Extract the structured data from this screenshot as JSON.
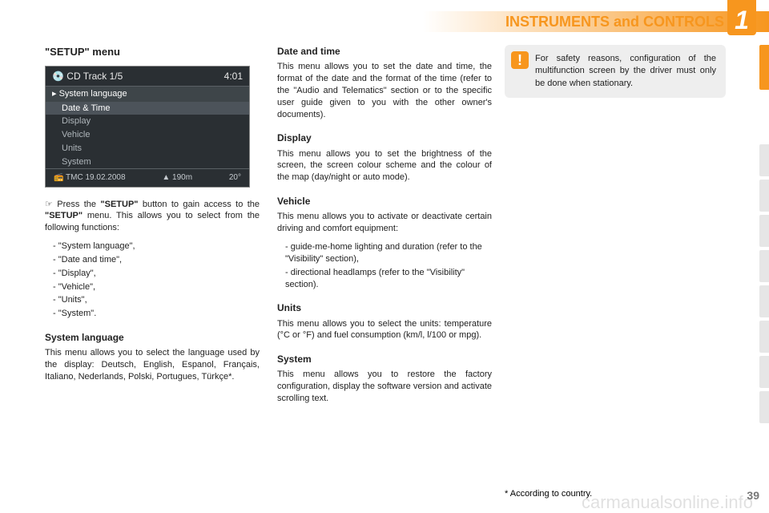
{
  "header": {
    "title": "INSTRUMENTS and CONTROLS",
    "chapter": "1"
  },
  "col1": {
    "heading": "\"SETUP\" menu",
    "screenshot": {
      "top_left": "💿 CD    Track 1/5",
      "top_right": "4:01",
      "menu_title": "▸ System language",
      "items": [
        "Date & Time",
        "Display",
        "Vehicle",
        "Units",
        "System"
      ],
      "bottom_left": "📻 TMC    19.02.2008",
      "bottom_mid": "▲ 190m",
      "bottom_right": "20°"
    },
    "press_text_pre": "☞  Press the ",
    "press_setup1": "\"SETUP\"",
    "press_text_mid": " button to gain access to the ",
    "press_setup2": "\"SETUP\"",
    "press_text_post": " menu. This allows you to select from the following functions:",
    "functions": [
      "-  \"System language\",",
      "-  \"Date and time\",",
      "-  \"Display\",",
      "-  \"Vehicle\",",
      "-  \"Units\",",
      "-  \"System\"."
    ],
    "syslang_h": "System language",
    "syslang_p": "This menu allows you to select the language used by the display: Deutsch, English, Espanol, Français, Italiano, Nederlands, Polski, Portugues, Türkçe*."
  },
  "col2": {
    "date_h": "Date and time",
    "date_p": "This menu allows you to set the date and time, the format of the date and the format of the time (refer to the \"Audio and Telematics\" section or to the specific user guide given to you with the other owner's documents).",
    "disp_h": "Display",
    "disp_p": "This menu allows you to set the brightness of the screen, the screen colour scheme and the colour of the map (day/night or auto mode).",
    "veh_h": "Vehicle",
    "veh_p": "This menu allows you to activate or deactivate certain driving and comfort equipment:",
    "veh_items": [
      "-  guide-me-home lighting and duration (refer to the \"Visibility\" section),",
      "-  directional headlamps (refer to the \"Visibility\" section)."
    ],
    "units_h": "Units",
    "units_p": "This menu allows you to select the units: temperature (°C or °F) and fuel consumption (km/l, l/100 or mpg).",
    "sys_h": "System",
    "sys_p": "This menu allows you to restore the factory configuration, display the software version and activate scrolling text."
  },
  "callout": {
    "icon": "!",
    "text": "For safety reasons, configuration of the multifunction screen by the driver must only be done when stationary."
  },
  "footer": {
    "note": "* According to country.",
    "page": "39"
  },
  "watermark": "carmanualsonline.info"
}
